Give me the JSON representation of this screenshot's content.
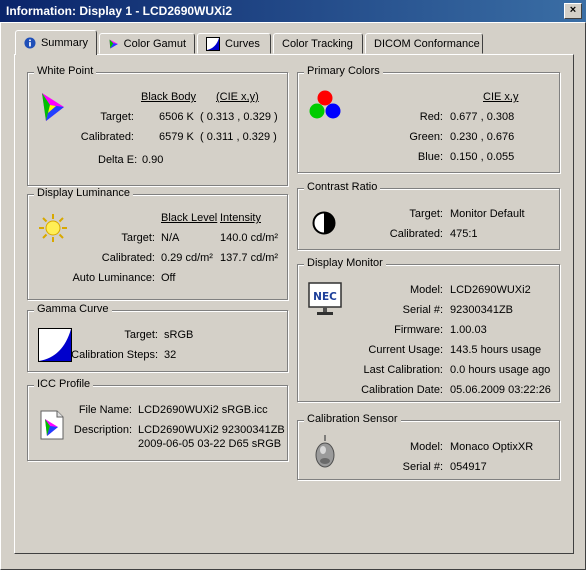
{
  "window": {
    "title": "Information: Display 1 - LCD2690WUXi2",
    "close_glyph": "×"
  },
  "tabs": [
    {
      "label": "Summary",
      "icon": "info-icon",
      "active": true
    },
    {
      "label": "Color Gamut",
      "icon": "color-gamut-icon",
      "active": false
    },
    {
      "label": "Curves",
      "icon": "curves-icon",
      "active": false
    },
    {
      "label": "Color Tracking",
      "icon": "",
      "active": false
    },
    {
      "label": "DICOM Conformance",
      "icon": "",
      "active": false
    }
  ],
  "white_point": {
    "title": "White Point",
    "col_black_body": "Black Body",
    "col_cie": "(CIE x,y)",
    "target_label": "Target:",
    "target_bb": "6506 K",
    "target_cie": "( 0.313 , 0.329 )",
    "calibrated_label": "Calibrated:",
    "calibrated_bb": "6579 K",
    "calibrated_cie": "( 0.311 , 0.329 )",
    "delta_e_label": "Delta E:",
    "delta_e_value": "0.90"
  },
  "luminance": {
    "title": "Display Luminance",
    "col_black": "Black Level",
    "col_intensity": "Intensity",
    "target_label": "Target:",
    "target_black": "N/A",
    "target_intensity": "140.0 cd/m²",
    "calibrated_label": "Calibrated:",
    "calibrated_black": "0.29 cd/m²",
    "calibrated_intensity": "137.7 cd/m²",
    "auto_label": "Auto Luminance:",
    "auto_value": "Off"
  },
  "gamma": {
    "title": "Gamma Curve",
    "target_label": "Target:",
    "target_value": "sRGB",
    "steps_label": "Calibration Steps:",
    "steps_value": "32"
  },
  "icc": {
    "title": "ICC Profile",
    "file_label": "File Name:",
    "file_value": "LCD2690WUXi2 sRGB.icc",
    "desc_label": "Description:",
    "desc_line1": "LCD2690WUXi2 92300341ZB",
    "desc_line2": "2009-06-05 03-22 D65 sRGB"
  },
  "primaries": {
    "title": "Primary Colors",
    "col_cie": "CIE x,y",
    "red_label": "Red:",
    "red_value": "0.677 , 0.308",
    "green_label": "Green:",
    "green_value": "0.230 , 0.676",
    "blue_label": "Blue:",
    "blue_value": "0.150 , 0.055"
  },
  "contrast": {
    "title": "Contrast Ratio",
    "target_label": "Target:",
    "target_value": "Monitor Default",
    "calibrated_label": "Calibrated:",
    "calibrated_value": "475:1"
  },
  "monitor": {
    "title": "Display Monitor",
    "logo": "NEC",
    "model_label": "Model:",
    "model_value": "LCD2690WUXi2",
    "serial_label": "Serial #:",
    "serial_value": "92300341ZB",
    "firmware_label": "Firmware:",
    "firmware_value": "1.00.03",
    "usage_label": "Current Usage:",
    "usage_value": "143.5 hours usage",
    "lastcal_label": "Last Calibration:",
    "lastcal_value": "0.0 hours usage ago",
    "caldate_label": "Calibration Date:",
    "caldate_value": "05.06.2009 03:22:26"
  },
  "sensor": {
    "title": "Calibration Sensor",
    "model_label": "Model:",
    "model_value": "Monaco OptixXR",
    "serial_label": "Serial #:",
    "serial_value": "054917"
  },
  "colors": {
    "titlebar_start": "#0a246a",
    "titlebar_end": "#3a6ea5",
    "face": "#d4d0c8",
    "gamma_fill": "#0000cc",
    "nec_blue": "#1d3f9a"
  }
}
